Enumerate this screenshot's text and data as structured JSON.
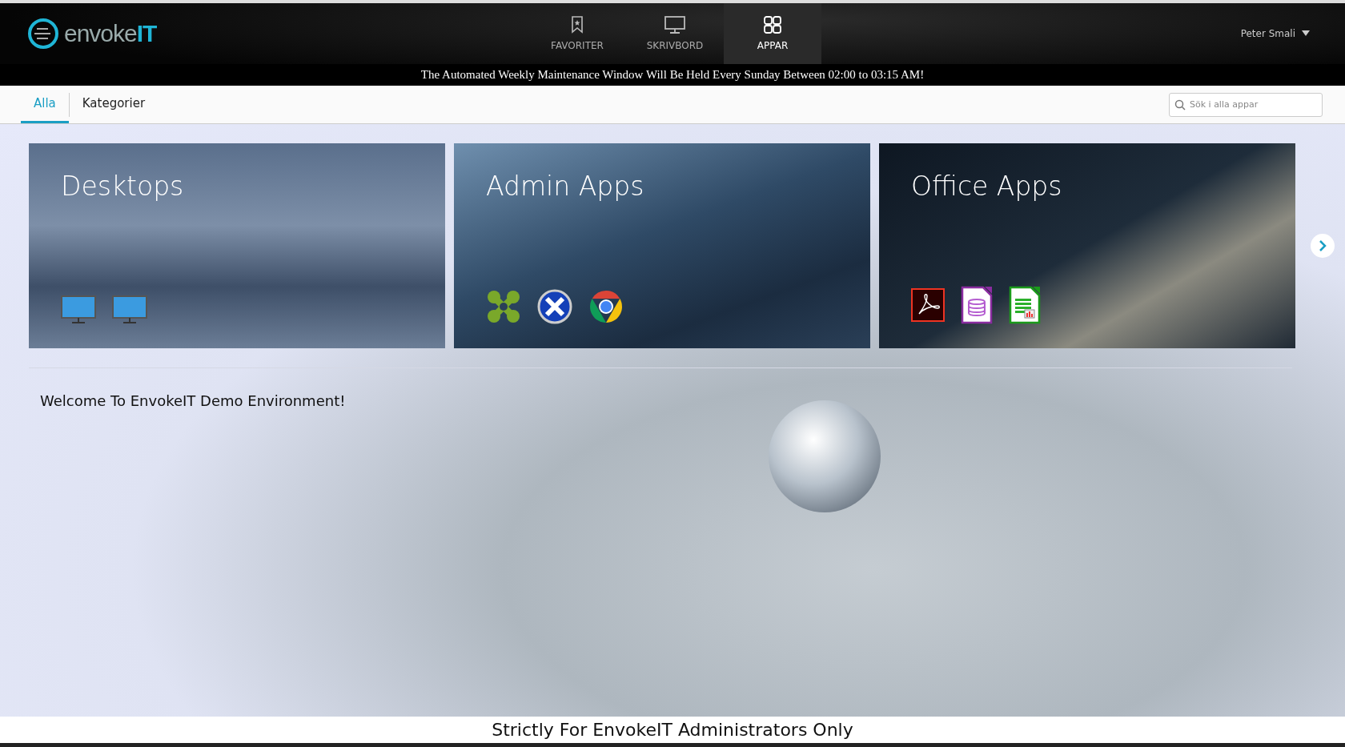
{
  "header": {
    "logo": "envoke**IT**",
    "nav": [
      {
        "label": "FAVORITER",
        "kind": "bookmark",
        "selected": false
      },
      {
        "label": "SKRIVBORD",
        "kind": "monitor",
        "selected": false
      },
      {
        "label": "APPAR",
        "kind": "grid",
        "selected": true
      }
    ],
    "user": "Peter Smali"
  },
  "announcement": "The Automated Weekly Maintenance Window Will Be Held Every Sunday Between 02:00 to 03:15 AM!",
  "tabs": [
    {
      "label": "Alla",
      "selected": true
    },
    {
      "label": "Kategorier",
      "selected": false
    }
  ],
  "search": {
    "placeholder": "Sök i alla appar"
  },
  "tiles": [
    {
      "title": "Desktops",
      "apps": [
        {
          "kind": "monitor"
        },
        {
          "kind": "monitor"
        }
      ]
    },
    {
      "title": "Admin Apps",
      "apps": [
        {
          "kind": "green-x"
        },
        {
          "kind": "blue-x"
        },
        {
          "kind": "browser"
        }
      ]
    },
    {
      "title": "Office Apps",
      "apps": [
        {
          "kind": "pdf"
        },
        {
          "kind": "database-doc"
        },
        {
          "kind": "spreadsheet-doc"
        }
      ]
    }
  ],
  "welcome": "Welcome To EnvokeIT Demo Environment!",
  "footer": "Strictly For EnvokeIT Administrators Only"
}
